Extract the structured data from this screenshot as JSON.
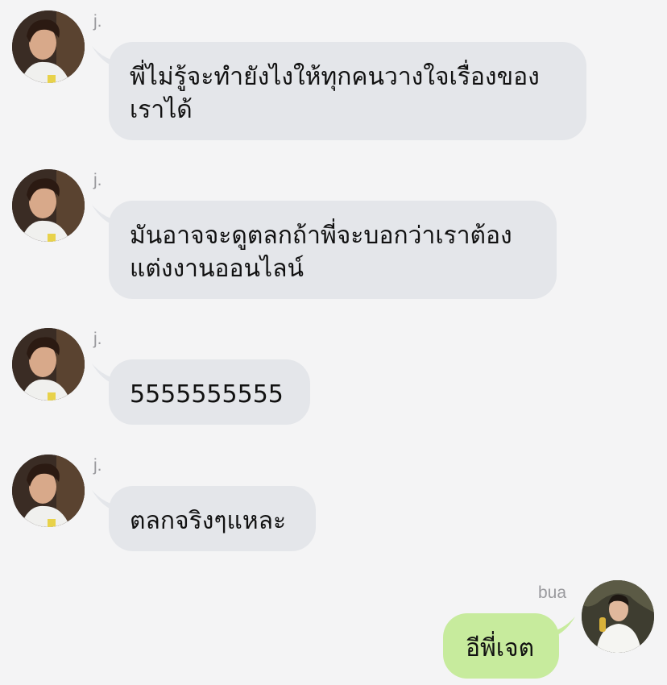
{
  "messages": [
    {
      "sender": "j.",
      "text_lines": [
        "พี่ไม่รู้จะทำยังไงให้ทุกคนวางใจเรื่องของ",
        "เราได้"
      ]
    },
    {
      "sender": "j.",
      "text_lines": [
        "มันอาจจะดูตลกถ้าพี่จะบอกว่าเราต้อง",
        "แต่งงานออนไลน์"
      ]
    },
    {
      "sender": "j.",
      "text_lines": [
        "5555555555"
      ]
    },
    {
      "sender": "j.",
      "text_lines": [
        "ตลกจริงๆแหละ"
      ]
    },
    {
      "sender": "bua",
      "text_lines": [
        "อีพี่เจต"
      ]
    }
  ],
  "colors": {
    "background": "#f4f4f5",
    "incoming_bubble": "#e4e6ea",
    "outgoing_bubble": "#c7eb9d",
    "sender_name": "#9a9a9e"
  }
}
